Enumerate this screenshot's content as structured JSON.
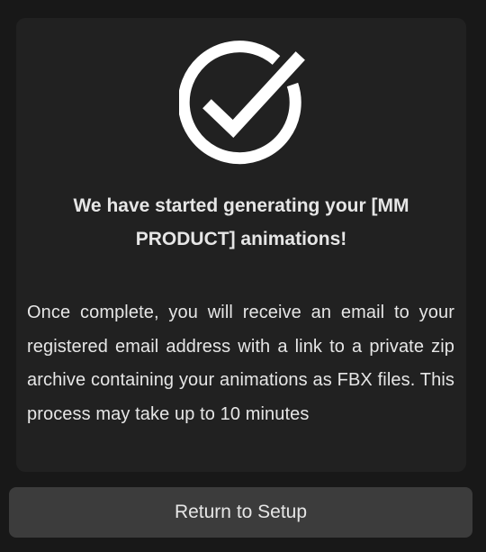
{
  "card": {
    "icon": "checkmark-circle-icon",
    "heading": "We have started generating your [MM PRODUCT] animations!",
    "message": "Once complete, you will receive an email to your registered email address with a link to a private zip archive containing your animations as FBX files. This process may take up to 10 minutes"
  },
  "actions": {
    "return_label": "Return to Setup"
  },
  "colors": {
    "page_bg": "#181818",
    "card_bg": "#212121",
    "text": "#e6e6e6",
    "icon": "#ffffff",
    "button_bg": "#3c3c3c"
  }
}
